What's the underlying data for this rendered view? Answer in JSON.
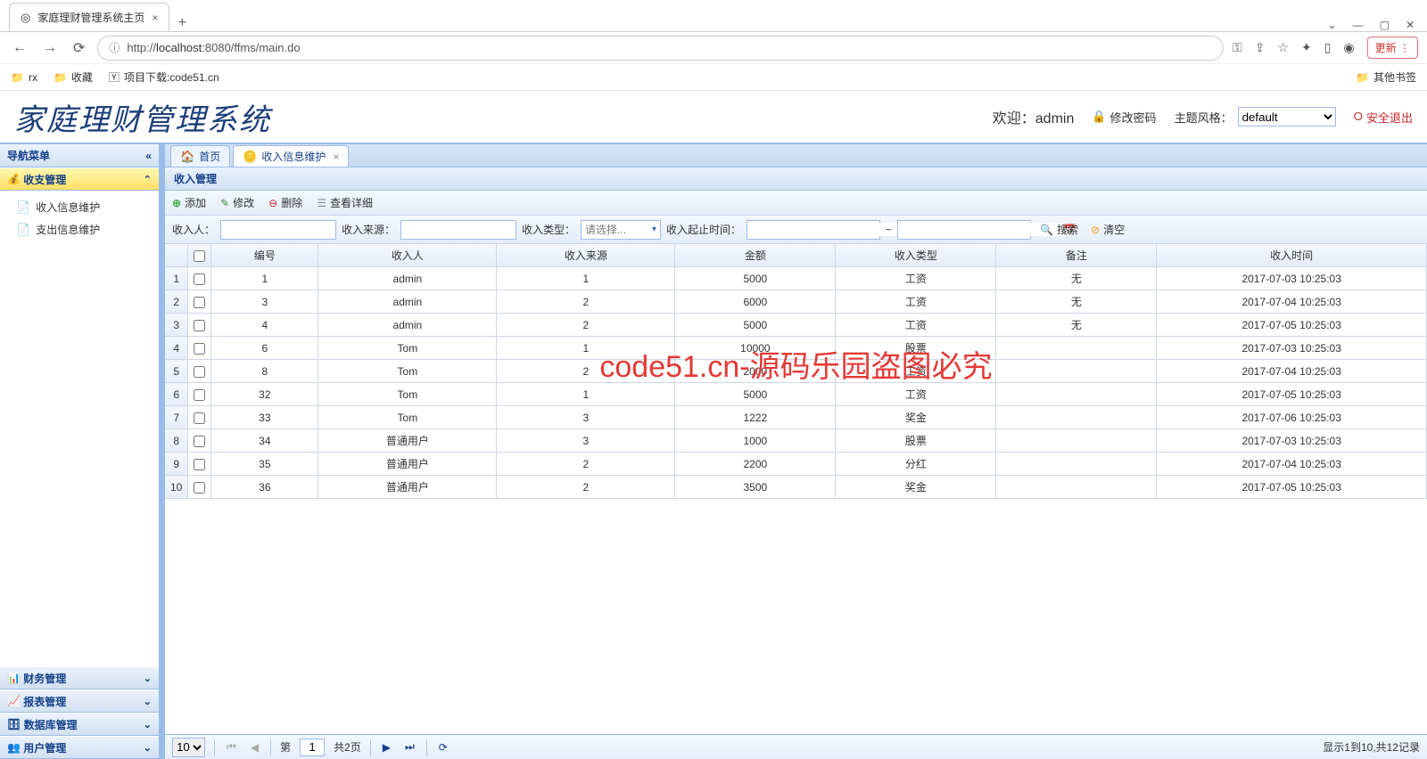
{
  "browser": {
    "tab_title": "家庭理财管理系统主页",
    "url_prefix": "http://",
    "url_host": "localhost",
    "url_path": ":8080/ffms/main.do",
    "update_label": "更新",
    "bookmarks": [
      "rx",
      "收藏",
      "项目下载:code51.cn"
    ],
    "other_bookmarks": "其他书签"
  },
  "header": {
    "app_title": "家庭理财管理系统",
    "welcome_prefix": "欢迎：",
    "user": "admin",
    "change_pwd": "修改密码",
    "theme_label": "主题风格：",
    "theme_value": "default",
    "logout": "安全退出"
  },
  "sidebar": {
    "title": "导航菜单",
    "sections": [
      {
        "label": "收支管理",
        "expanded": true
      },
      {
        "label": "财务管理",
        "expanded": false
      },
      {
        "label": "报表管理",
        "expanded": false
      },
      {
        "label": "数据库管理",
        "expanded": false
      },
      {
        "label": "用户管理",
        "expanded": false
      }
    ],
    "items": [
      {
        "label": "收入信息维护"
      },
      {
        "label": "支出信息维护"
      }
    ]
  },
  "tabs": {
    "home": "首页",
    "active": "收入信息维护"
  },
  "panel_title": "收入管理",
  "toolbar": {
    "add": "添加",
    "edit": "修改",
    "del": "删除",
    "view": "查看详细"
  },
  "search": {
    "person_label": "收入人：",
    "source_label": "收入来源：",
    "type_label": "收入类型：",
    "type_placeholder": "请选择...",
    "date_label": "收入起止时间：",
    "date_sep": "~",
    "search_btn": "搜索",
    "clear_btn": "清空"
  },
  "columns": [
    "编号",
    "收入人",
    "收入来源",
    "金额",
    "收入类型",
    "备注",
    "收入时间"
  ],
  "rows": [
    {
      "n": "1",
      "c": [
        "1",
        "admin",
        "1",
        "5000",
        "工资",
        "无",
        "2017-07-03 10:25:03"
      ]
    },
    {
      "n": "2",
      "c": [
        "3",
        "admin",
        "2",
        "6000",
        "工资",
        "无",
        "2017-07-04 10:25:03"
      ]
    },
    {
      "n": "3",
      "c": [
        "4",
        "admin",
        "2",
        "5000",
        "工资",
        "无",
        "2017-07-05 10:25:03"
      ]
    },
    {
      "n": "4",
      "c": [
        "6",
        "Tom",
        "1",
        "10000",
        "股票",
        "",
        "2017-07-03 10:25:03"
      ]
    },
    {
      "n": "5",
      "c": [
        "8",
        "Tom",
        "2",
        "2000",
        "工资",
        "",
        "2017-07-04 10:25:03"
      ]
    },
    {
      "n": "6",
      "c": [
        "32",
        "Tom",
        "1",
        "5000",
        "工资",
        "",
        "2017-07-05 10:25:03"
      ]
    },
    {
      "n": "7",
      "c": [
        "33",
        "Tom",
        "3",
        "1222",
        "奖金",
        "",
        "2017-07-06 10:25:03"
      ]
    },
    {
      "n": "8",
      "c": [
        "34",
        "普通用户",
        "3",
        "1000",
        "股票",
        "",
        "2017-07-03 10:25:03"
      ]
    },
    {
      "n": "9",
      "c": [
        "35",
        "普通用户",
        "2",
        "2200",
        "分红",
        "",
        "2017-07-04 10:25:03"
      ]
    },
    {
      "n": "10",
      "c": [
        "36",
        "普通用户",
        "2",
        "3500",
        "奖金",
        "",
        "2017-07-05 10:25:03"
      ]
    }
  ],
  "pager": {
    "page_size": "10",
    "page_label_prefix": "第",
    "page": "1",
    "total_pages": "共2页",
    "info": "显示1到10,共12记录"
  },
  "watermark": "code51.cn-源码乐园盗图必究"
}
